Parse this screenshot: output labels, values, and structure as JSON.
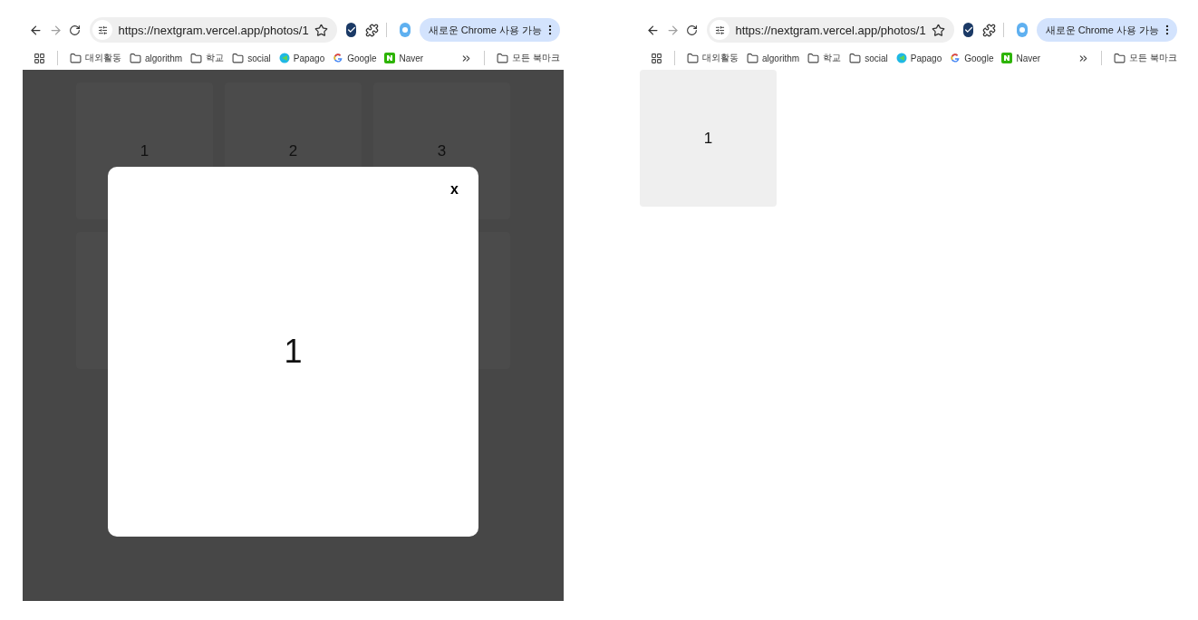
{
  "windows": [
    {
      "toolbar": {
        "url": "https://nextgram.vercel.app/photos/1",
        "update_button": "새로운 Chrome 사용 가능"
      },
      "bookmarks": [
        {
          "kind": "folder",
          "label": "대외활동"
        },
        {
          "kind": "folder",
          "label": "algorithm"
        },
        {
          "kind": "folder",
          "label": "학교"
        },
        {
          "kind": "folder",
          "label": "social"
        },
        {
          "kind": "papago",
          "label": "Papago"
        },
        {
          "kind": "google",
          "label": "Google"
        },
        {
          "kind": "naver",
          "label": "Naver"
        }
      ],
      "all_bookmarks": "모든 북마크",
      "page": {
        "kind": "dimmed",
        "tiles": [
          {
            "kind": "label",
            "label": "1"
          },
          {
            "kind": "label",
            "label": "2"
          },
          {
            "kind": "label",
            "label": "3"
          },
          {
            "kind": "blank"
          },
          {
            "kind": "blank"
          }
        ],
        "modal": {
          "close": "x",
          "content": "1"
        }
      }
    },
    {
      "toolbar": {
        "url": "https://nextgram.vercel.app/photos/1",
        "update_button": "새로운 Chrome 사용 가능"
      },
      "bookmarks": [
        {
          "kind": "folder",
          "label": "대외활동"
        },
        {
          "kind": "folder",
          "label": "algorithm"
        },
        {
          "kind": "folder",
          "label": "학교"
        },
        {
          "kind": "folder",
          "label": "social"
        },
        {
          "kind": "papago",
          "label": "Papago"
        },
        {
          "kind": "google",
          "label": "Google"
        },
        {
          "kind": "naver",
          "label": "Naver"
        }
      ],
      "all_bookmarks": "모든 북마크",
      "page": {
        "kind": "plain",
        "tiles": [
          {
            "kind": "label",
            "label": "1"
          }
        ]
      }
    }
  ]
}
